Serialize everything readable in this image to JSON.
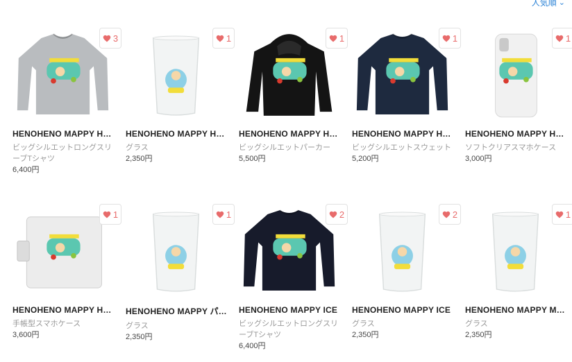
{
  "sort": {
    "label": "人気順"
  },
  "colors": {
    "heart": "#e86b6b",
    "link": "#2a82d6"
  },
  "products": [
    {
      "name": "HENOHENO MAPPY Ha…",
      "type": "ビッグシルエットロングスリーブTシャツ",
      "price": "6,400円",
      "likes": "3",
      "kind": "longsleeve",
      "color": "#b9bcbf"
    },
    {
      "name": "HENOHENO MAPPY Ha…",
      "type": "グラス",
      "price": "2,350円",
      "likes": "1",
      "kind": "glass",
      "color": "#f2f4f4"
    },
    {
      "name": "HENOHENO MAPPY Ha…",
      "type": "ビッグシルエットパーカー",
      "price": "5,500円",
      "likes": "1",
      "kind": "hoodie",
      "color": "#141414"
    },
    {
      "name": "HENOHENO MAPPY Ha…",
      "type": "ビッグシルエットスウェット",
      "price": "5,200円",
      "likes": "1",
      "kind": "sweat",
      "color": "#1e2a3f"
    },
    {
      "name": "HENOHENO MAPPY Ha…",
      "type": "ソフトクリアスマホケース",
      "price": "3,000円",
      "likes": "1",
      "kind": "phone",
      "color": "#f1f1f1"
    },
    {
      "name": "HENOHENO MAPPY Ha…",
      "type": "手帳型スマホケース",
      "price": "3,600円",
      "likes": "1",
      "kind": "notebook",
      "color": "#ececec"
    },
    {
      "name": "HENOHENO MAPPY パ…",
      "type": "グラス",
      "price": "2,350円",
      "likes": "1",
      "kind": "glass",
      "color": "#f2f4f4"
    },
    {
      "name": "HENOHENO MAPPY ICE",
      "type": "ビッグシルエットロングスリーブTシャツ",
      "price": "6,400円",
      "likes": "2",
      "kind": "longsleeve",
      "color": "#171b2b"
    },
    {
      "name": "HENOHENO MAPPY ICE",
      "type": "グラス",
      "price": "2,350円",
      "likes": "2",
      "kind": "glass",
      "color": "#f2f4f4"
    },
    {
      "name": "HENOHENO MAPPY MA…",
      "type": "グラス",
      "price": "2,350円",
      "likes": "1",
      "kind": "glass",
      "color": "#f2f4f4"
    }
  ]
}
